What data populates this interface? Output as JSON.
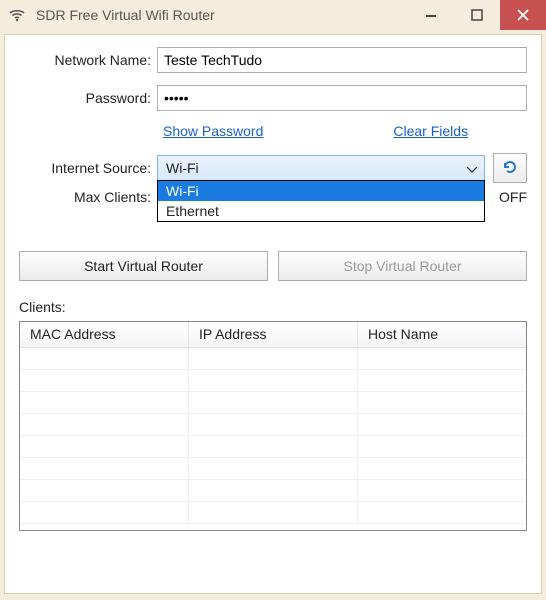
{
  "window": {
    "title": "SDR Free Virtual Wifi Router"
  },
  "form": {
    "network_name_label": "Network Name:",
    "network_name_value": "Teste TechTudo",
    "password_label": "Password:",
    "password_value": "•••••",
    "show_password": "Show Password",
    "clear_fields": "Clear Fields",
    "internet_source_label": "Internet Source:",
    "internet_source_value": "Wi-Fi",
    "internet_source_options": [
      "Wi-Fi",
      "Ethernet"
    ],
    "max_clients_label": "Max Clients:",
    "status_text": "OFF"
  },
  "buttons": {
    "start": "Start Virtual Router",
    "stop": "Stop Virtual Router"
  },
  "clients": {
    "label": "Clients:",
    "columns": [
      "MAC Address",
      "IP Address",
      "Host Name"
    ],
    "rows": []
  }
}
